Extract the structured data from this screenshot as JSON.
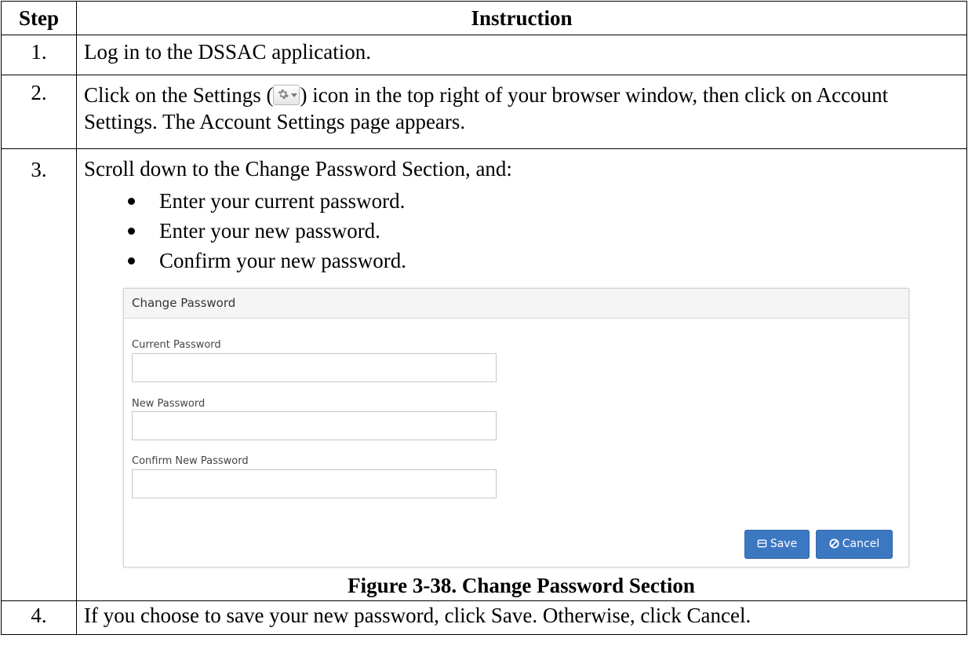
{
  "table": {
    "header_step": "Step",
    "header_instruction": "Instruction"
  },
  "steps": [
    {
      "number": "1.",
      "text": "Log in to the DSSAC application."
    },
    {
      "number": "2.",
      "text_before_icon": "Click on the Settings (",
      "icon": "settings-gear-dropdown-icon",
      "text_after_icon": ") icon in the top right of your browser window, then click on Account Settings.  The Account Settings page appears."
    },
    {
      "number": "3.",
      "text": "Scroll down to the Change Password Section, and:",
      "bullets": [
        "Enter your current password.",
        "Enter your new password.",
        "Confirm your new password."
      ],
      "figure": {
        "panel_title": "Change Password",
        "current_password_label": "Current Password",
        "new_password_label": "New Password",
        "confirm_password_label": "Confirm New Password",
        "current_password_value": "",
        "new_password_value": "",
        "confirm_password_value": "",
        "save_label": "Save",
        "cancel_label": "Cancel",
        "button_color": "#3c78c2",
        "caption": "Figure 3-38. Change Password Section"
      }
    },
    {
      "number": "4.",
      "text": "If you choose to save your new password, click Save. Otherwise, click Cancel."
    }
  ]
}
